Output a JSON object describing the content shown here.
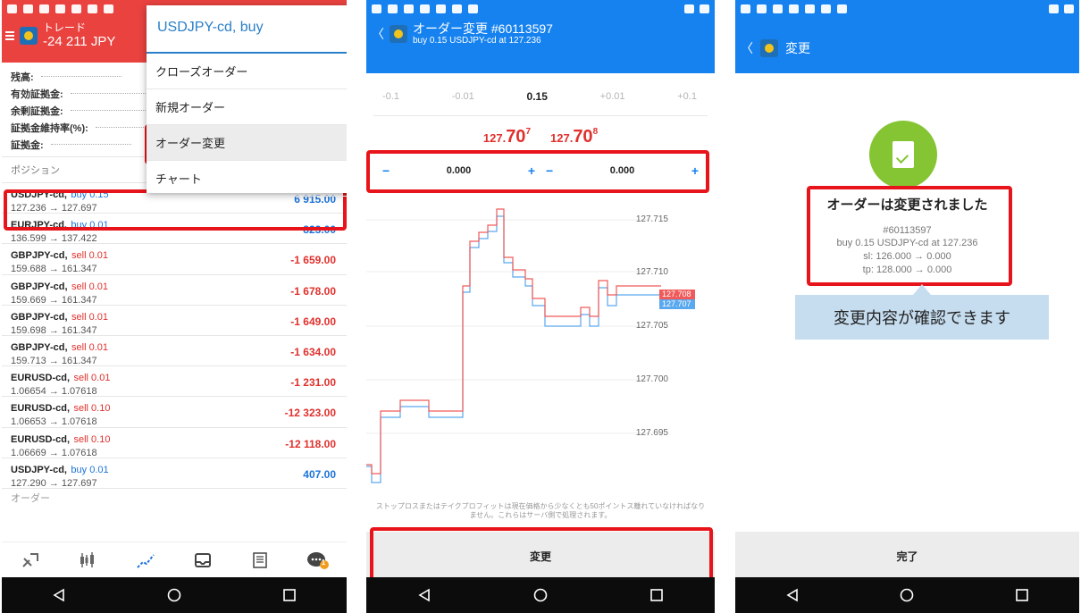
{
  "panel1": {
    "status_color": "#e9423f",
    "header": {
      "title": "トレード",
      "pl": "-24 211 JPY"
    },
    "account": [
      {
        "label": "残高:"
      },
      {
        "label": "有効証拠金:"
      },
      {
        "label": "余剰証拠金:"
      },
      {
        "label": "証拠金維持率(%):"
      },
      {
        "label": "証拠金:"
      }
    ],
    "positions_label": "ポジション",
    "positions": [
      {
        "symbol": "USDJPY-cd,",
        "side": "buy 0.15",
        "prices": "127.236 → 127.697",
        "pl": "6 915.00",
        "dir": "buy"
      },
      {
        "symbol": "EURJPY-cd,",
        "side": "buy 0.01",
        "prices": "136.599 → 137.422",
        "pl": "823.00",
        "dir": "buy"
      },
      {
        "symbol": "GBPJPY-cd,",
        "side": "sell 0.01",
        "prices": "159.688 → 161.347",
        "pl": "-1 659.00",
        "dir": "sell"
      },
      {
        "symbol": "GBPJPY-cd,",
        "side": "sell 0.01",
        "prices": "159.669 → 161.347",
        "pl": "-1 678.00",
        "dir": "sell"
      },
      {
        "symbol": "GBPJPY-cd,",
        "side": "sell 0.01",
        "prices": "159.698 → 161.347",
        "pl": "-1 649.00",
        "dir": "sell"
      },
      {
        "symbol": "GBPJPY-cd,",
        "side": "sell 0.01",
        "prices": "159.713 → 161.347",
        "pl": "-1 634.00",
        "dir": "sell"
      },
      {
        "symbol": "EURUSD-cd,",
        "side": "sell 0.01",
        "prices": "1.06654 → 1.07618",
        "pl": "-1 231.00",
        "dir": "sell"
      },
      {
        "symbol": "EURUSD-cd,",
        "side": "sell 0.10",
        "prices": "1.06653 → 1.07618",
        "pl": "-12 323.00",
        "dir": "sell"
      },
      {
        "symbol": "EURUSD-cd,",
        "side": "sell 0.10",
        "prices": "1.06669 → 1.07618",
        "pl": "-12 118.00",
        "dir": "sell"
      },
      {
        "symbol": "USDJPY-cd,",
        "side": "buy 0.01",
        "prices": "127.290 → 127.697",
        "pl": "407.00",
        "dir": "buy"
      }
    ],
    "orders_label": "オーダー",
    "popup": {
      "title": "USDJPY-cd, buy",
      "items": [
        "クローズオーダー",
        "新規オーダー",
        "オーダー変更",
        "チャート"
      ]
    },
    "tabs": [
      "quotes-icon",
      "chart-icon",
      "trade-icon",
      "history-icon",
      "news-icon",
      "chat-icon"
    ],
    "chat_badge": "1"
  },
  "panel2": {
    "header": {
      "title": "オーダー変更 #60113597",
      "subtitle": "buy 0.15 USDJPY-cd at 127.236"
    },
    "volume": {
      "m01": "-0.1",
      "m001": "-0.01",
      "current": "0.15",
      "p001": "+0.01",
      "p01": "+0.1"
    },
    "quotes": {
      "bid_prefix": "127.",
      "bid_main": "70",
      "bid_sup": "7",
      "ask_prefix": "127.",
      "ask_main": "70",
      "ask_sup": "8"
    },
    "stop_loss": "0.000",
    "take_profit": "0.000",
    "chart_axis": [
      "127.715",
      "127.710",
      "127.705",
      "127.700",
      "127.695"
    ],
    "ask_tag": "127.708",
    "bid_tag": "127.707",
    "disclaimer": "ストップロスまたはテイクプロフィットは現在価格から少なくとも50ポイントス離れていなければなりません。これらはサーバ側で処理されます。",
    "button": "変更"
  },
  "panel3": {
    "header": {
      "title": "変更"
    },
    "done_title": "オーダーは変更されました",
    "lines": [
      "#60113597",
      "buy 0.15 USDJPY-cd at 127.236",
      "sl: 126.000 → 0.000",
      "tp: 128.000 → 0.000"
    ],
    "callout": "変更内容が確認できます",
    "button": "完了"
  },
  "colors": {
    "red": "#e9423f",
    "blue": "#1582f0",
    "highlight": "#e8141b",
    "green": "#85c534"
  }
}
